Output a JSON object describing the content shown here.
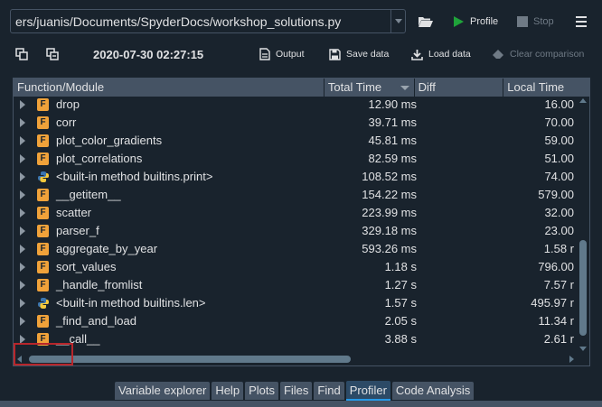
{
  "toolbar": {
    "file_path": "ers/juanis/Documents/SpyderDocs/workshop_solutions.py",
    "profile_label": "Profile",
    "stop_label": "Stop"
  },
  "subtoolbar": {
    "datetime": "2020-07-30 02:27:15",
    "output_label": "Output",
    "save_label": "Save data",
    "load_label": "Load data",
    "clear_label": "Clear comparison"
  },
  "tree": {
    "columns": [
      "Function/Module",
      "Total Time",
      "Diff",
      "Local Time"
    ],
    "rows": [
      {
        "icon": "F",
        "name": "drop",
        "total": "12.90 ms",
        "local": "16.00"
      },
      {
        "icon": "F",
        "name": "corr",
        "total": "39.71 ms",
        "local": "70.00"
      },
      {
        "icon": "F",
        "name": "plot_color_gradients",
        "total": "45.81 ms",
        "local": "59.00"
      },
      {
        "icon": "F",
        "name": "plot_correlations",
        "total": "82.59 ms",
        "local": "51.00"
      },
      {
        "icon": "python",
        "name": "<built-in method builtins.print>",
        "total": "108.52 ms",
        "local": "74.00"
      },
      {
        "icon": "F",
        "name": "__getitem__",
        "total": "154.22 ms",
        "local": "579.00"
      },
      {
        "icon": "F",
        "name": "scatter",
        "total": "223.99 ms",
        "local": "32.00"
      },
      {
        "icon": "F",
        "name": "parser_f",
        "total": "329.18 ms",
        "local": "23.00"
      },
      {
        "icon": "F",
        "name": "aggregate_by_year",
        "total": "593.26 ms",
        "local": "1.58 r"
      },
      {
        "icon": "F",
        "name": "sort_values",
        "total": "1.18 s",
        "local": "796.00"
      },
      {
        "icon": "F",
        "name": "_handle_fromlist",
        "total": "1.27 s",
        "local": "7.57 r"
      },
      {
        "icon": "python",
        "name": "<built-in method builtins.len>",
        "total": "1.57 s",
        "local": "495.97 r"
      },
      {
        "icon": "F",
        "name": "_find_and_load",
        "total": "2.05 s",
        "local": "11.34 r"
      },
      {
        "icon": "F",
        "name": "__call__",
        "total": "3.88 s",
        "local": "2.61 r"
      }
    ]
  },
  "tabs": [
    "Variable explorer",
    "Help",
    "Plots",
    "Files",
    "Find",
    "Profiler",
    "Code Analysis"
  ],
  "active_tab": "Profiler",
  "colors": {
    "background": "#19232d",
    "header": "#455364",
    "accent": "#259ae9",
    "function_icon": "#f0a23a",
    "highlight": "#b8262b"
  }
}
